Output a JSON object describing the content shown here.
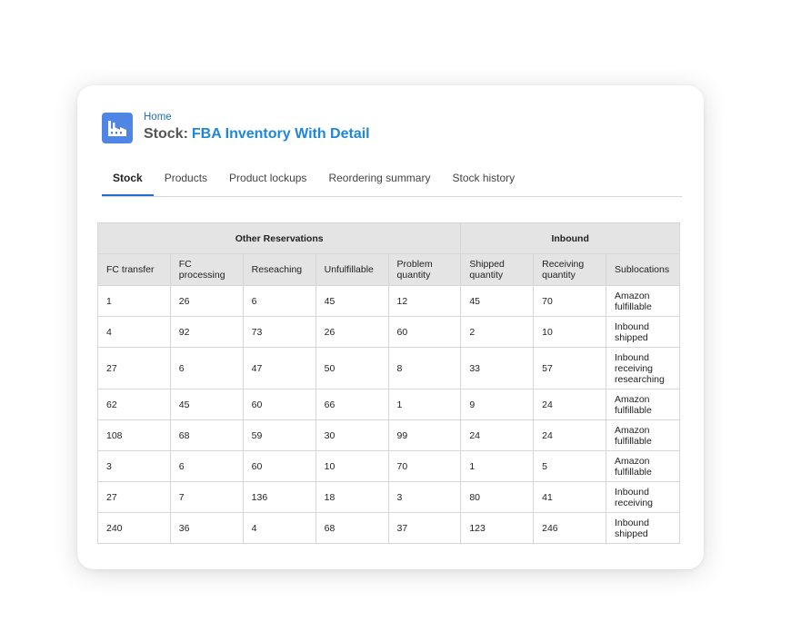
{
  "header": {
    "breadcrumb": "Home",
    "title_prefix": "Stock:",
    "title": "FBA Inventory With Detail",
    "icon": "factory-icon",
    "accent_color": "#1f86e0",
    "icon_bg_color": "#4f86e6"
  },
  "tabs": [
    {
      "label": "Stock",
      "active": true
    },
    {
      "label": "Products",
      "active": false
    },
    {
      "label": "Product lockups",
      "active": false
    },
    {
      "label": "Reordering summary",
      "active": false
    },
    {
      "label": "Stock history",
      "active": false
    }
  ],
  "table": {
    "groups": [
      "Other Reservations",
      "Inbound"
    ],
    "columns": [
      [
        "FC transfer"
      ],
      [
        "FC",
        "processing"
      ],
      [
        "Reseaching"
      ],
      [
        "Unfulfillable"
      ],
      [
        "Problem",
        "quantity"
      ],
      [
        "Shipped",
        "quantity"
      ],
      [
        "Receiving",
        "quantity"
      ],
      [
        "Sublocations"
      ]
    ],
    "rows": [
      [
        "1",
        "26",
        "6",
        "45",
        "12",
        "45",
        "70",
        [
          "Amazon",
          "fulfillable"
        ]
      ],
      [
        "4",
        "92",
        "73",
        "26",
        "60",
        "2",
        "10",
        [
          "Inbound",
          "shipped"
        ]
      ],
      [
        "27",
        "6",
        "47",
        "50",
        "8",
        "33",
        "57",
        [
          "Inbound",
          "receiving",
          "researching"
        ]
      ],
      [
        "62",
        "45",
        "60",
        "66",
        "1",
        "9",
        "24",
        [
          "Amazon",
          "fulfillable"
        ]
      ],
      [
        "108",
        "68",
        "59",
        "30",
        "99",
        "24",
        "24",
        [
          "Amazon",
          "fulfillable"
        ]
      ],
      [
        "3",
        "6",
        "60",
        "10",
        "70",
        "1",
        "5",
        [
          "Amazon",
          "fulfillable"
        ]
      ],
      [
        "27",
        "7",
        "136",
        "18",
        "3",
        "80",
        "41",
        [
          "Inbound",
          "receiving"
        ]
      ],
      [
        "240",
        "36",
        "4",
        "68",
        "37",
        "123",
        "246",
        [
          "Inbound",
          "shipped"
        ]
      ]
    ]
  }
}
